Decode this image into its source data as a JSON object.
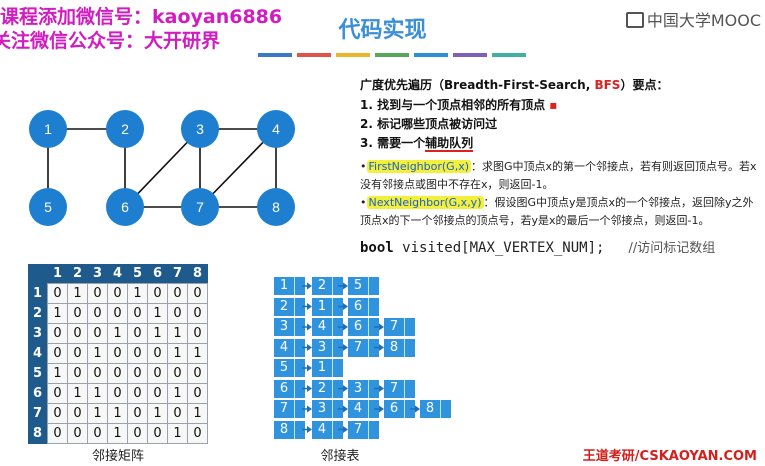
{
  "watermark": {
    "line1": "课程添加微信号：kaoyan6886",
    "line2": "关注微信公众号：大开研界"
  },
  "logo": {
    "text": "中国大学MOOC",
    "icon": "mooc-logo-icon"
  },
  "slide": {
    "title": "代码实现"
  },
  "stripes": [
    "#3a79c8",
    "#e0534a",
    "#f0b429",
    "#56a65b",
    "#2c8fcf",
    "#7b5fb8",
    "#42b0a0"
  ],
  "bfs": {
    "heading_pre": "广度优先遍历（Breadth-First-Search, ",
    "heading_red": "BFS",
    "heading_post": "）要点：",
    "points": [
      "1.  找到与一个顶点相邻的所有顶点",
      "2.  标记哪些顶点被访问过",
      "3.  需要一个"
    ],
    "point3_highlight": "辅助队列",
    "first_fn": "FirstNeighbor(G,x)",
    "first_desc": "：求图G中顶点x的第一个邻接点，若有则返回顶点号。若x没有邻接点或图中不存在x，则返回-1。",
    "next_fn": "NextNeighbor(G,x,y)",
    "next_desc": "：假设图G中顶点y是顶点x的一个邻接点，返回除y之外顶点x的下一个邻接点的顶点号，若y是x的最后一个邻接点，则返回-1。"
  },
  "code": {
    "keyword": "bool",
    "rest": "visited[MAX_VERTEX_NUM];",
    "comment": "//访问标记数组"
  },
  "graph": {
    "nodes": [
      "1",
      "2",
      "3",
      "4",
      "5",
      "6",
      "7",
      "8"
    ],
    "edges": [
      [
        "1",
        "2"
      ],
      [
        "1",
        "5"
      ],
      [
        "2",
        "6"
      ],
      [
        "3",
        "4"
      ],
      [
        "3",
        "6"
      ],
      [
        "3",
        "7"
      ],
      [
        "4",
        "7"
      ],
      [
        "4",
        "8"
      ],
      [
        "6",
        "7"
      ],
      [
        "7",
        "8"
      ]
    ],
    "node_color": "#1e7fd0"
  },
  "matrix": {
    "headers": [
      "1",
      "2",
      "3",
      "4",
      "5",
      "6",
      "7",
      "8"
    ],
    "rows": [
      [
        "0",
        "1",
        "0",
        "0",
        "1",
        "0",
        "0",
        "0"
      ],
      [
        "1",
        "0",
        "0",
        "0",
        "0",
        "1",
        "0",
        "0"
      ],
      [
        "0",
        "0",
        "0",
        "1",
        "0",
        "1",
        "1",
        "0"
      ],
      [
        "0",
        "0",
        "1",
        "0",
        "0",
        "0",
        "1",
        "1"
      ],
      [
        "1",
        "0",
        "0",
        "0",
        "0",
        "0",
        "0",
        "0"
      ],
      [
        "0",
        "1",
        "1",
        "0",
        "0",
        "0",
        "1",
        "0"
      ],
      [
        "0",
        "0",
        "1",
        "1",
        "0",
        "1",
        "0",
        "1"
      ],
      [
        "0",
        "0",
        "0",
        "1",
        "0",
        "0",
        "1",
        "0"
      ]
    ],
    "caption": "邻接矩阵"
  },
  "adjlist": {
    "vertices": [
      "1",
      "2",
      "3",
      "4",
      "5",
      "6",
      "7",
      "8"
    ],
    "lists": [
      [
        "2",
        "5"
      ],
      [
        "1",
        "6"
      ],
      [
        "4",
        "6",
        "7"
      ],
      [
        "3",
        "7",
        "8"
      ],
      [
        "1"
      ],
      [
        "2",
        "3",
        "7"
      ],
      [
        "3",
        "4",
        "6",
        "8"
      ],
      [
        "4",
        "7"
      ]
    ],
    "caption": "邻接表"
  },
  "footer": "王道考研/CSKAOYAN.COM"
}
